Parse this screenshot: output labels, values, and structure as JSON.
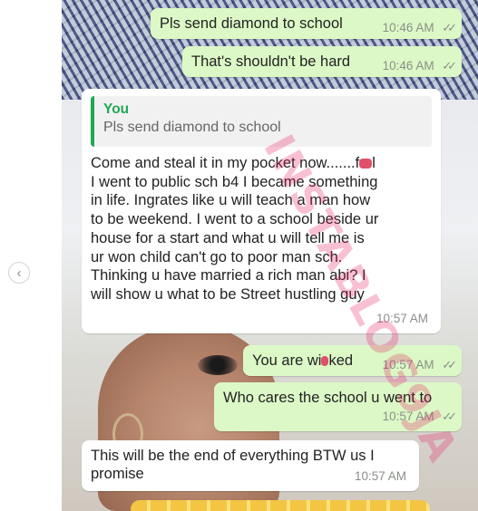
{
  "messages": [
    {
      "text": "Pls send diamond to school",
      "time": "10:46 AM",
      "ticks": "✓✓"
    },
    {
      "text": "That's shouldn't be hard",
      "time": "10:46 AM",
      "ticks": "✓✓"
    },
    {
      "quote_author": "You",
      "quote_text": "Pls send diamond to school",
      "lines": [
        "Come and steal it in my pocket now.......f",
        "I went to public sch b4 I became something",
        "in life. Ingrates like u will teach a man how",
        "to be weekend. I went to a school beside ur",
        "house for a start and what u will tell me is",
        "ur won child can't go to poor man sch.",
        "Thinking u have married a rich man abi? I",
        "will show u what to be Street hustling guy"
      ],
      "line1_tail": "l",
      "time": "10:57 AM"
    },
    {
      "text_a": "You are wi",
      "text_b": "ked",
      "time": "10:57 AM",
      "ticks": "✓✓"
    },
    {
      "text": "Who cares the school u went to",
      "time": "10:57 AM",
      "ticks": "✓✓"
    },
    {
      "lines": [
        "This will be the end of everything BTW us I",
        "promise"
      ],
      "time": "10:57 AM"
    }
  ],
  "watermark": "INSTABLOG9JA",
  "icons": {
    "carousel_prev": "chevron-left-icon",
    "read_receipt": "double-check-icon"
  },
  "colors": {
    "outgoing_bubble": "#dcf8c6",
    "incoming_bubble": "#ffffff",
    "quote_accent": "#1fa855",
    "watermark": "#e91e63"
  }
}
